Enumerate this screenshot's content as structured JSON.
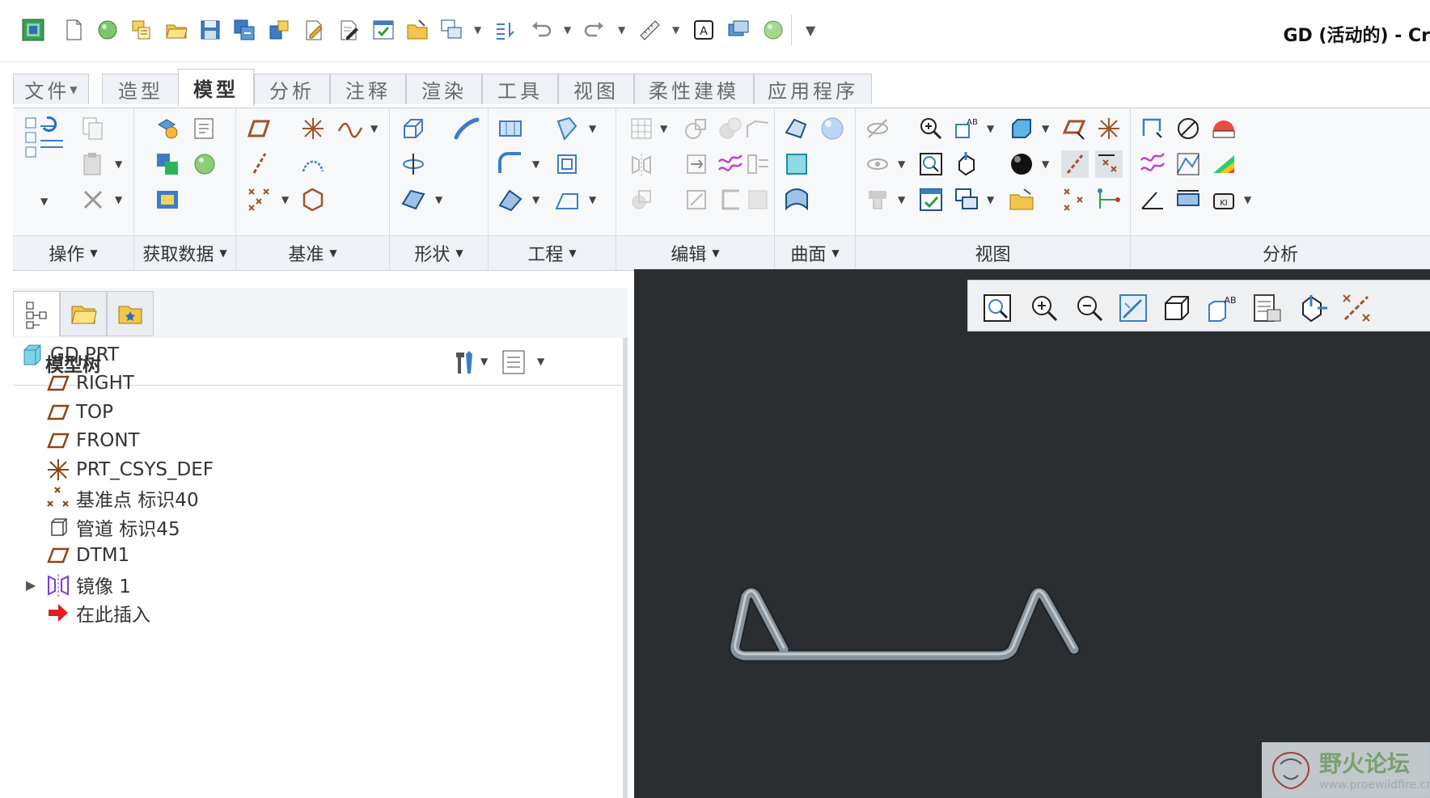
{
  "window": {
    "title": "GD (活动的) - Cr"
  },
  "tabs": [
    {
      "label": "文件",
      "has_dropdown": true
    },
    {
      "label": "造型"
    },
    {
      "label": "模型",
      "active": true
    },
    {
      "label": "分析"
    },
    {
      "label": "注释"
    },
    {
      "label": "渲染"
    },
    {
      "label": "工具"
    },
    {
      "label": "视图"
    },
    {
      "label": "柔性建模"
    },
    {
      "label": "应用程序"
    }
  ],
  "ribbon": {
    "groups": [
      {
        "label": "操作",
        "has_dropdown": true
      },
      {
        "label": "获取数据",
        "has_dropdown": true
      },
      {
        "label": "基准",
        "has_dropdown": true
      },
      {
        "label": "形状",
        "has_dropdown": true
      },
      {
        "label": "工程",
        "has_dropdown": true
      },
      {
        "label": "编辑",
        "has_dropdown": true
      },
      {
        "label": "曲面",
        "has_dropdown": true
      },
      {
        "label": "视图",
        "has_dropdown": false
      },
      {
        "label": "分析",
        "has_dropdown": false
      }
    ]
  },
  "model_tree": {
    "title": "模型树",
    "items": [
      {
        "label": "GD.PRT",
        "icon": "part-icon"
      },
      {
        "label": "RIGHT",
        "icon": "datum-plane-icon"
      },
      {
        "label": "TOP",
        "icon": "datum-plane-icon"
      },
      {
        "label": "FRONT",
        "icon": "datum-plane-icon"
      },
      {
        "label": "PRT_CSYS_DEF",
        "icon": "coordinate-system-icon"
      },
      {
        "label": "基准点 标识40",
        "icon": "datum-point-icon"
      },
      {
        "label": "管道 标识45",
        "icon": "pipe-icon"
      },
      {
        "label": "DTM1",
        "icon": "datum-plane-icon"
      },
      {
        "label": "镜像 1",
        "icon": "mirror-icon",
        "expandable": true
      },
      {
        "label": "在此插入",
        "icon": "insert-here-arrow-icon"
      }
    ]
  },
  "watermark": {
    "name": "野火论坛",
    "url": "www.proewildfire.cn"
  },
  "colors": {
    "viewport_bg": "#2b2e31",
    "datum_plane": "#8b4513",
    "pipe": "#8a949c",
    "insert_arrow": "#e02020"
  }
}
